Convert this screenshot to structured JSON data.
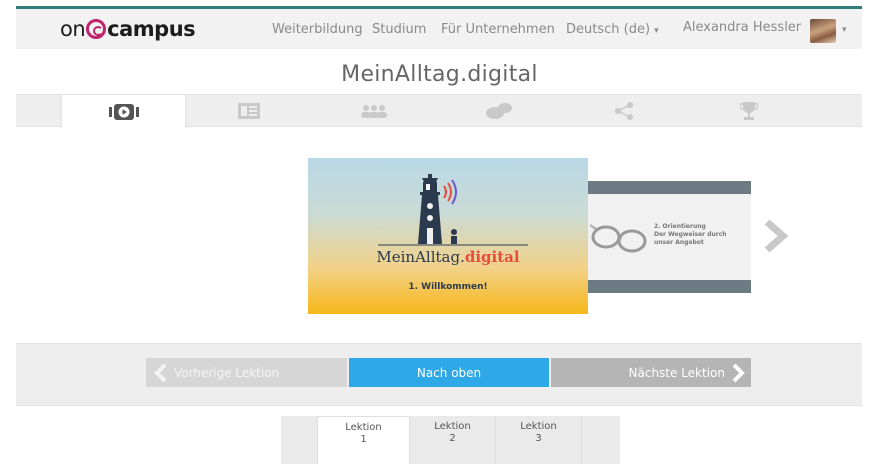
{
  "brand": {
    "logo_prefix": "on",
    "logo_suffix": "campus"
  },
  "nav": {
    "items": [
      "Weiterbildung",
      "Studium",
      "Für Unternehmen"
    ],
    "language": "Deutsch (de)",
    "user_name": "Alexandra Hessler"
  },
  "course_title": "MeinAlltag.digital",
  "tab_icons": [
    "video-icon",
    "news-icon",
    "participants-icon",
    "discussion-icon",
    "share-icon",
    "trophy-icon"
  ],
  "carousel": {
    "slide1": {
      "brand_main": "MeinAlltag.",
      "brand_digital": "digital",
      "caption": "1. Willkommen!"
    },
    "slide2": {
      "line1": "2. Orientierung",
      "line2": "Der Wegweiser durch",
      "line3": "unser Angebot"
    }
  },
  "lesson_nav": {
    "prev": "Vorherige Lektion",
    "up": "Nach oben",
    "next": "Nächste Lektion"
  },
  "lesson_tabs": [
    {
      "label": "Lektion",
      "num": "1"
    },
    {
      "label": "Lektion",
      "num": "2"
    },
    {
      "label": "Lektion",
      "num": "3"
    }
  ],
  "colors": {
    "accent_teal": "#2f7c7a",
    "brand_magenta": "#c0246e",
    "button_blue": "#2ea8e6"
  }
}
